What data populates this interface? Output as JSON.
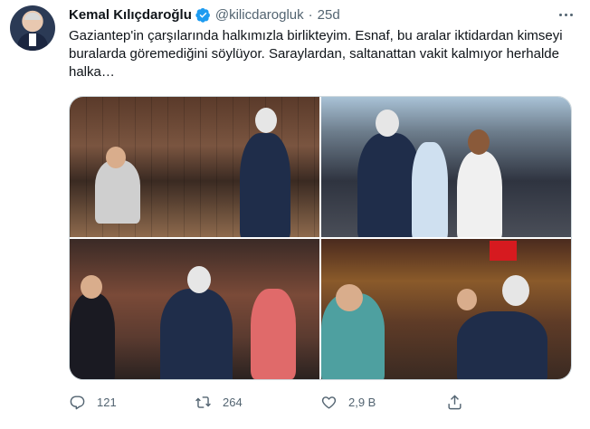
{
  "tweet": {
    "author_name": "Kemal Kılıçdaroğlu",
    "handle": "@kilicdarogluk",
    "separator": "·",
    "time": "25d",
    "text": "Gaziantep'in çarşılarında halkımızla birlikteyim. Esnaf, bu aralar iktidardan kimseyi buralarda göremediğini söylüyor. Saraylardan, saltanattan vakit kalmıyor herhalde halka…",
    "verified_color": "#1d9bf0",
    "photo_count": 4
  },
  "actions": {
    "reply_count": "121",
    "retweet_count": "264",
    "like_count": "2,9 B",
    "icons": [
      "reply-icon",
      "retweet-icon",
      "like-icon",
      "share-icon"
    ]
  }
}
